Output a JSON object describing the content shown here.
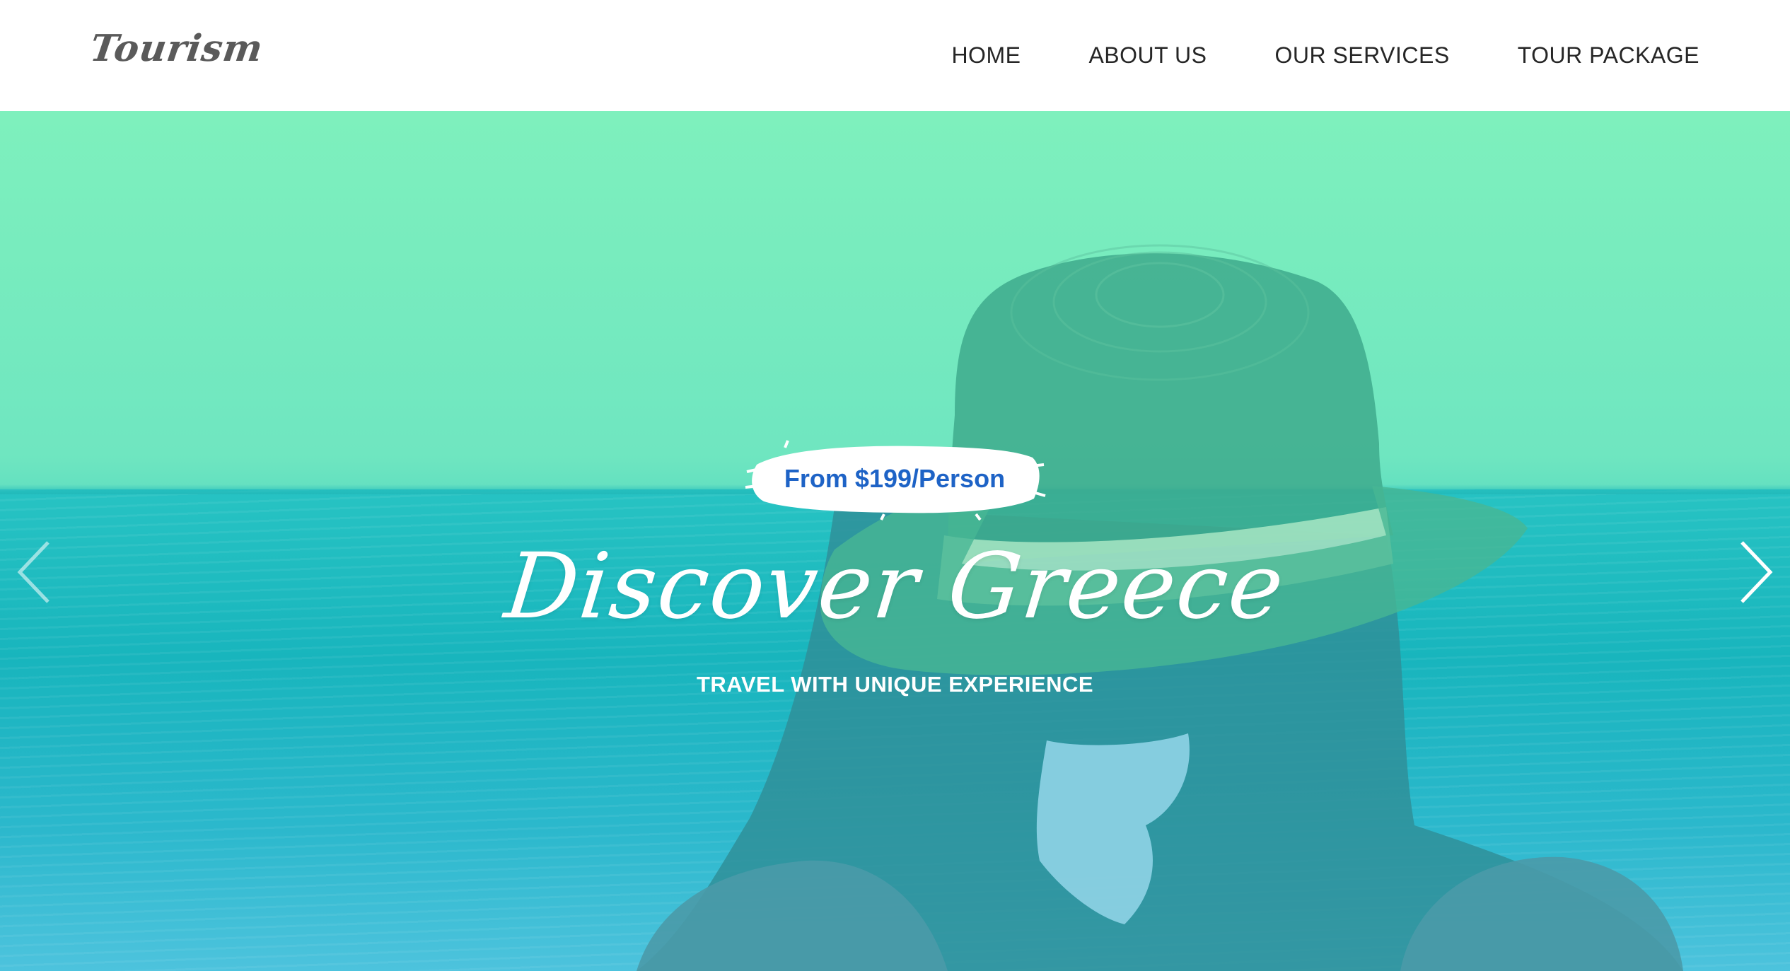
{
  "header": {
    "logo": "Tourism",
    "nav": [
      {
        "label": "HOME"
      },
      {
        "label": "ABOUT US"
      },
      {
        "label": "OUR SERVICES"
      },
      {
        "label": "TOUR PACKAGE"
      }
    ]
  },
  "hero": {
    "price_badge": "From $199/Person",
    "title": "Discover Greece",
    "subtitle": "TRAVEL WITH UNIQUE EXPERIENCE",
    "prev_icon": "chevron-left-icon",
    "next_icon": "chevron-right-icon"
  },
  "colors": {
    "overlay_top": "#7ef0bd",
    "overlay_bottom": "#39b8cf",
    "price_text": "#1e63c6",
    "nav_text": "#262626",
    "logo_text": "#5a5a5a"
  }
}
